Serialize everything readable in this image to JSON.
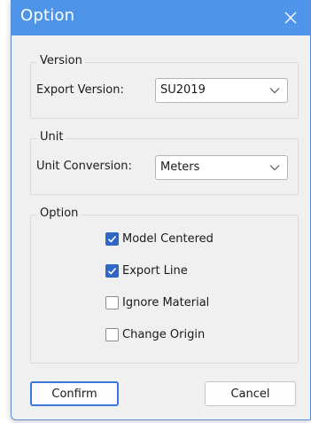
{
  "window": {
    "title": "Option",
    "accent_color": "#4e95ea",
    "close_icon": "close-icon"
  },
  "version_group": {
    "legend": "Version",
    "label": "Export Version:",
    "selected": "SU2019"
  },
  "unit_group": {
    "legend": "Unit",
    "label": "Unit Conversion:",
    "selected": "Meters"
  },
  "option_group": {
    "legend": "Option",
    "checkboxes": [
      {
        "label": "Model Centered",
        "checked": true
      },
      {
        "label": "Export Line",
        "checked": true
      },
      {
        "label": "Ignore Material",
        "checked": false
      },
      {
        "label": "Change Origin",
        "checked": false
      }
    ]
  },
  "buttons": {
    "confirm": "Confirm",
    "cancel": "Cancel"
  }
}
